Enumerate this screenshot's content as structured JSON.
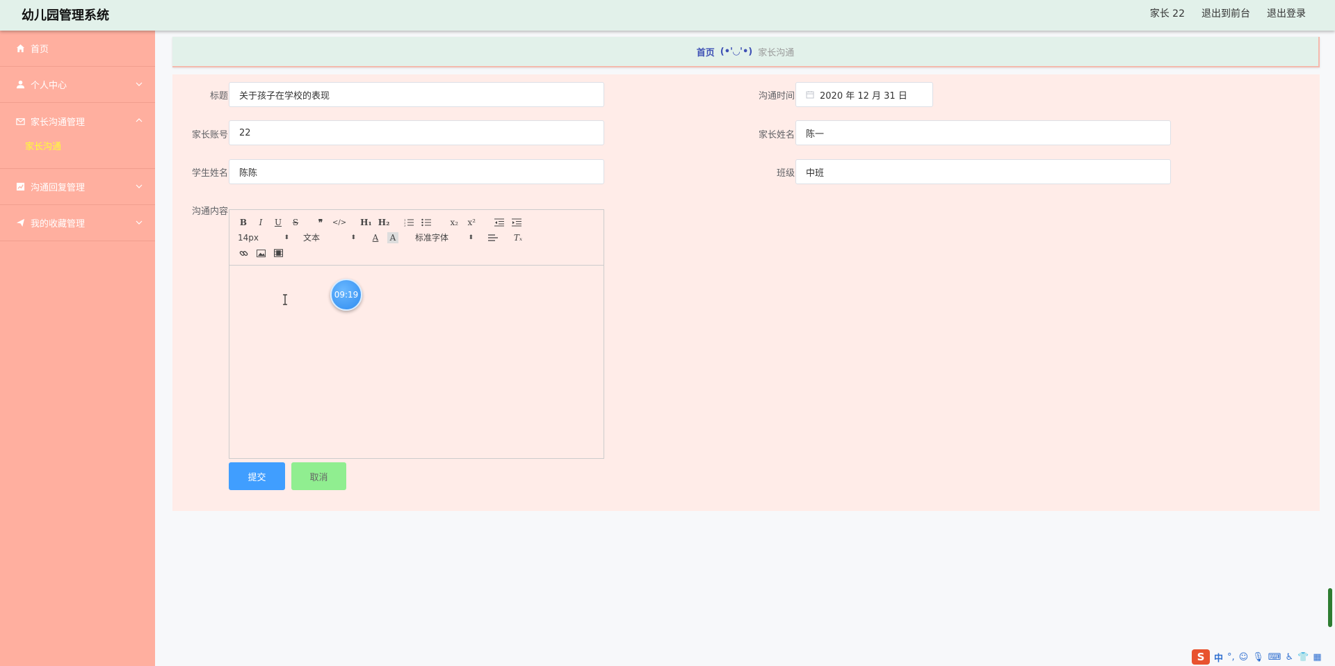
{
  "header": {
    "app_title": "幼儿园管理系统",
    "user_label": "家长 22",
    "to_front": "退出到前台",
    "logout": "退出登录"
  },
  "sidebar": {
    "items": [
      {
        "label": "首页",
        "icon": "home-icon"
      },
      {
        "label": "个人中心",
        "icon": "user-icon"
      },
      {
        "label": "家长沟通管理",
        "icon": "mail-icon",
        "sub": [
          "家长沟通"
        ]
      },
      {
        "label": "沟通回复管理",
        "icon": "chart-icon"
      },
      {
        "label": "我的收藏管理",
        "icon": "send-icon"
      }
    ]
  },
  "breadcrumb": {
    "home": "首页",
    "separator": "(•'◡'•)",
    "current": "家长沟通"
  },
  "form": {
    "title_label": "标题",
    "title_value": "关于孩子在学校的表现",
    "time_label": "沟通时间",
    "time_value": "2020 年 12 月 31 日",
    "account_label": "家长账号",
    "account_value": "22",
    "parent_name_label": "家长姓名",
    "parent_name_value": "陈一",
    "student_name_label": "学生姓名",
    "student_name_value": "陈陈",
    "class_label": "班级",
    "class_value": "中班",
    "content_label": "沟通内容"
  },
  "editor": {
    "font_size": "14px",
    "paragraph": "文本",
    "font_family": "标准字体",
    "timer": "09:19"
  },
  "buttons": {
    "submit": "提交",
    "cancel": "取消"
  },
  "tray": {
    "ime": "中"
  },
  "colors": {
    "header_bg": "#e2f1ea",
    "sidebar_bg": "#ffaf9f",
    "panel_bg": "#ffece8",
    "submit": "#409eff",
    "cancel": "#90ee90",
    "active_sub": "#ffff33"
  }
}
